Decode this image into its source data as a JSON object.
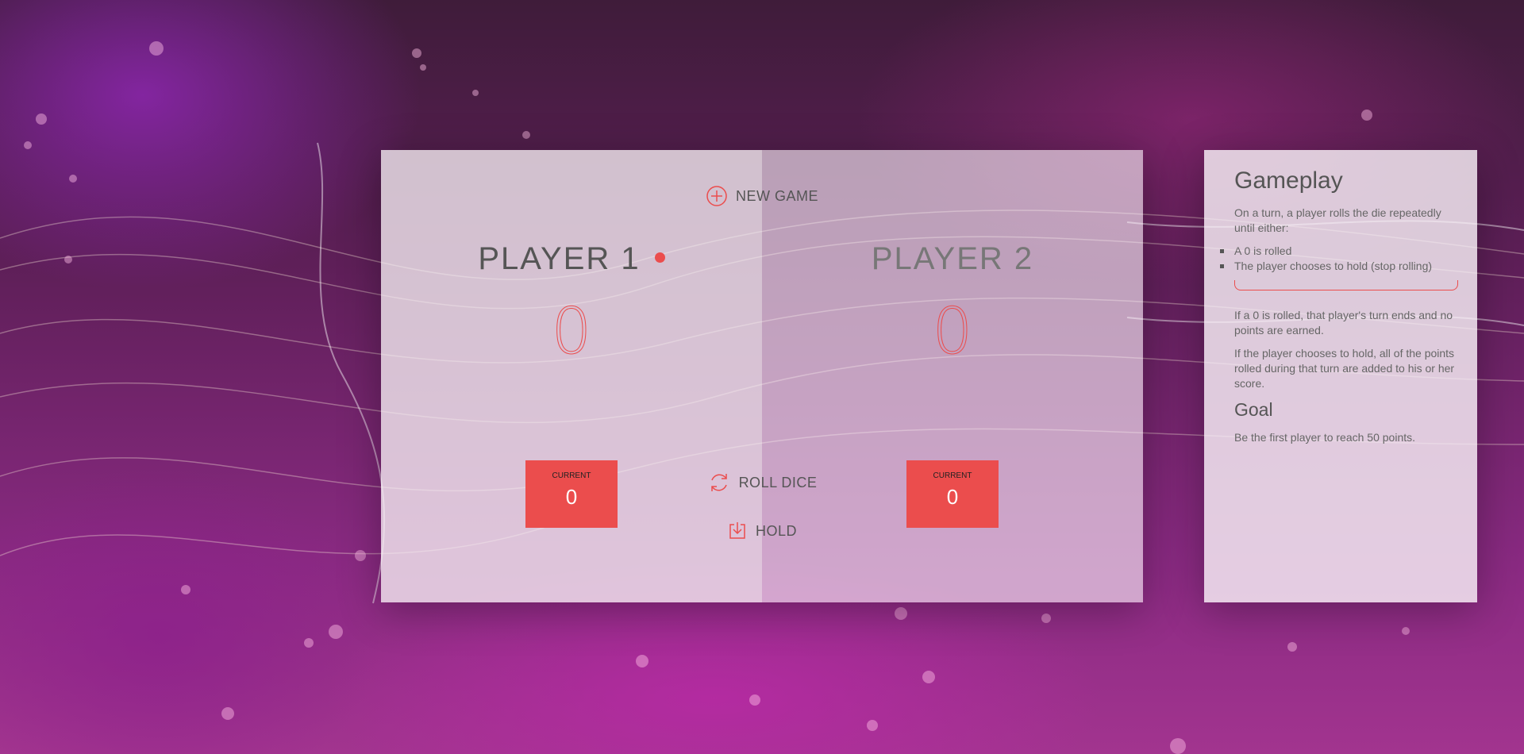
{
  "colors": {
    "accent": "#eb4d4d",
    "text": "#555555",
    "panel": "#f4edf2"
  },
  "game": {
    "new_game_label": "NEW GAME",
    "new_game_icon": "plus-circle-icon",
    "roll_dice_label": "ROLL DICE",
    "roll_dice_icon": "refresh-icon",
    "hold_label": "HOLD",
    "hold_icon": "download-icon",
    "players": [
      {
        "name": "PLAYER 1",
        "score": "0",
        "current_label": "CURRENT",
        "current_score": "0",
        "active": true
      },
      {
        "name": "PLAYER 2",
        "score": "0",
        "current_label": "CURRENT",
        "current_score": "0",
        "active": false
      }
    ]
  },
  "gameplay": {
    "title": "Gameplay",
    "intro": "On a turn, a player rolls the die repeatedly until either:",
    "rules": [
      "A 0 is rolled",
      "The player chooses to hold (stop rolling)"
    ],
    "rule_zero": "If a 0 is rolled, that player's turn ends and no points are earned.",
    "rule_hold": "If the player chooses to hold, all of the points rolled during that turn are added to his or her score.",
    "goal_title": "Goal",
    "goal_text": "Be the first player to reach 50 points."
  }
}
